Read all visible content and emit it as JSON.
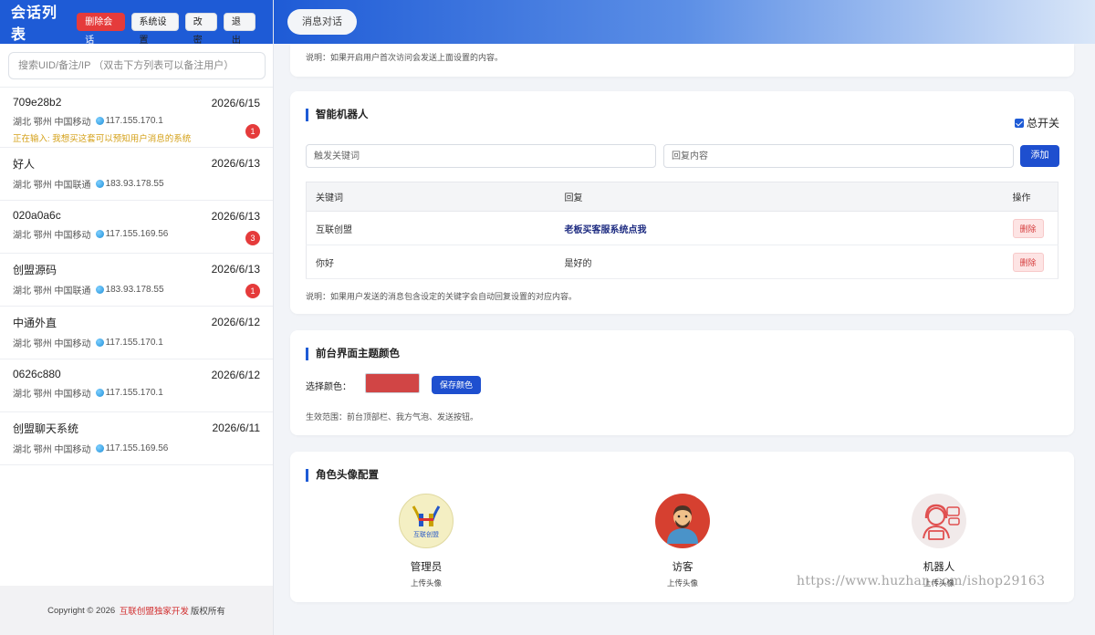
{
  "sidebar": {
    "title": "会话列表",
    "buttons": {
      "delete": "删除会话",
      "settings": "系统设置",
      "edit": "改密",
      "logout": "退出"
    },
    "search_placeholder": "搜索UID/备注/IP （双击下方列表可以备注用户）",
    "conversations": [
      {
        "name": "709e28b2",
        "date": "2026/6/15",
        "location": "湖北 鄂州 中国移动",
        "ip": "117.155.170.1",
        "typing": "正在输入: 我想买这套可以预知用户消息的系统",
        "badge": "1"
      },
      {
        "name": "好人",
        "date": "2026/6/13",
        "location": "湖北 鄂州 中国联通",
        "ip": "183.93.178.55",
        "badge": ""
      },
      {
        "name": "020a0a6c",
        "date": "2026/6/13",
        "location": "湖北 鄂州 中国移动",
        "ip": "117.155.169.56",
        "badge": "3"
      },
      {
        "name": "创盟源码",
        "date": "2026/6/13",
        "location": "湖北 鄂州 中国联通",
        "ip": "183.93.178.55",
        "badge": "1"
      },
      {
        "name": "中通外直",
        "date": "2026/6/12",
        "location": "湖北 鄂州 中国移动",
        "ip": "117.155.170.1",
        "badge": ""
      },
      {
        "name": "0626c880",
        "date": "2026/6/12",
        "location": "湖北 鄂州 中国移动",
        "ip": "117.155.170.1",
        "badge": ""
      },
      {
        "name": "创盟聊天系统",
        "date": "2026/6/11",
        "location": "湖北 鄂州 中国移动",
        "ip": "117.155.169.56",
        "badge": ""
      }
    ],
    "footer": {
      "prefix": "Copyright © 2026",
      "brand": "互联创盟独家开发",
      "suffix": "版权所有"
    }
  },
  "header": {
    "chat_tab": "消息对话"
  },
  "first_visit": {
    "note": "说明：如果开启用户首次访问会发送上面设置的内容。"
  },
  "robot": {
    "title": "智能机器人",
    "master_switch": "总开关",
    "keyword_placeholder": "触发关键词",
    "reply_placeholder": "回复内容",
    "add_label": "添加",
    "columns": {
      "keyword": "关键词",
      "reply": "回复",
      "action": "操作"
    },
    "rows": [
      {
        "keyword": "互联创盟",
        "reply": "老板买客服系统点我",
        "action": "删除"
      },
      {
        "keyword": "你好",
        "reply": "是好的",
        "action": "删除"
      }
    ],
    "note": "说明：如果用户发送的消息包含设定的关键字会自动回复设置的对应内容。"
  },
  "theme": {
    "title": "前台界面主题颜色",
    "select_label": "选择颜色：",
    "color": "#d14545",
    "save_label": "保存颜色",
    "scope_note": "生效范围：前台顶部栏、我方气泡、发送按钮。"
  },
  "avatars": {
    "title": "角色头像配置",
    "roles": [
      {
        "name": "管理员",
        "upload": "上传头像",
        "logo_text": "互联创盟"
      },
      {
        "name": "访客",
        "upload": "上传头像"
      },
      {
        "name": "机器人",
        "upload": "上传头像"
      }
    ]
  },
  "watermark": "https://www.huzhan.com/ishop29163"
}
